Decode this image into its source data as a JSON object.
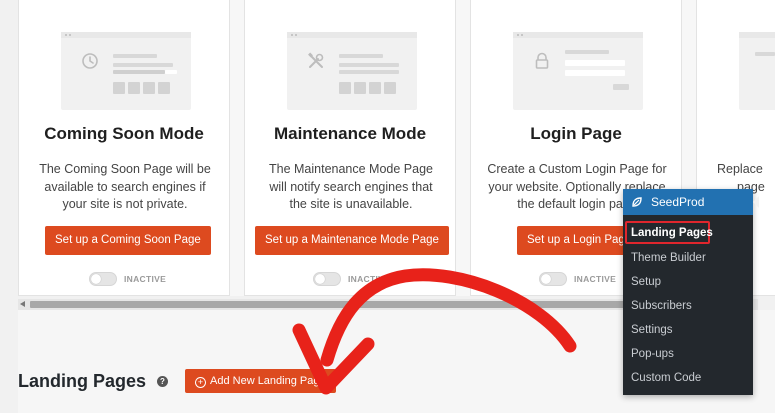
{
  "cards": [
    {
      "title": "Coming Soon Mode",
      "desc": "The Coming Soon Page will be available to search engines if your site is not private.",
      "button": "Set up a Coming Soon Page",
      "status": "INACTIVE",
      "icon": "clock-icon"
    },
    {
      "title": "Maintenance Mode",
      "desc": "The Maintenance Mode Page will notify search engines that the site is unavailable.",
      "button": "Set up a Maintenance Mode Page",
      "status": "INACTIVE",
      "icon": "tools-icon"
    },
    {
      "title": "Login Page",
      "desc": "Create a Custom Login Page for your website. Optionally replace the default login page",
      "button": "Set up a Login Page",
      "status": "INACTIVE",
      "icon": "lock-icon"
    },
    {
      "desc_line1": "Replace",
      "desc_line2": "page"
    }
  ],
  "landing": {
    "title": "Landing Pages",
    "add_button": "Add New Landing Page"
  },
  "menu": {
    "header": "SeedProd",
    "items": [
      "Landing Pages",
      "Theme Builder",
      "Setup",
      "Subscribers",
      "Settings",
      "Pop-ups",
      "Custom Code"
    ],
    "active_index": 0
  },
  "colors": {
    "accent": "#dd4a1f",
    "menu_bg": "#23282d",
    "menu_header": "#2271b1",
    "highlight": "#e0262d",
    "arrow": "#e8221a"
  }
}
